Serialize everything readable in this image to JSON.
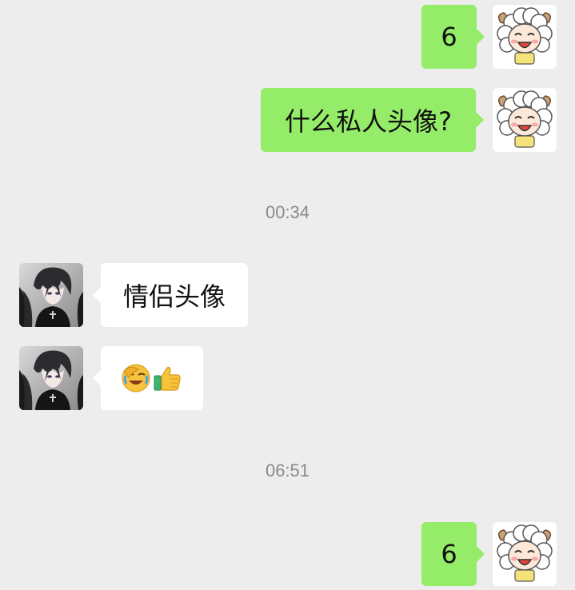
{
  "colors": {
    "background": "#ededed",
    "my_bubble": "#95ec69",
    "peer_bubble": "#ffffff",
    "timestamp_text": "#8a8a8a"
  },
  "messages": [
    {
      "sender": "me",
      "text": "6",
      "avatar": "lamb-cartoon-avatar"
    },
    {
      "sender": "me",
      "text": "什么私人头像?",
      "avatar": "lamb-cartoon-avatar"
    },
    {
      "timestamp": "00:34"
    },
    {
      "sender": "peer",
      "text": "情侣头像",
      "avatar": "dark-anime-boy-avatar"
    },
    {
      "sender": "peer",
      "emojis": [
        "facepalm-laughing-emoji",
        "thumbs-up-emoji"
      ],
      "avatar": "dark-anime-boy-avatar"
    },
    {
      "timestamp": "06:51"
    },
    {
      "sender": "me",
      "text": "6",
      "avatar": "lamb-cartoon-avatar"
    }
  ]
}
